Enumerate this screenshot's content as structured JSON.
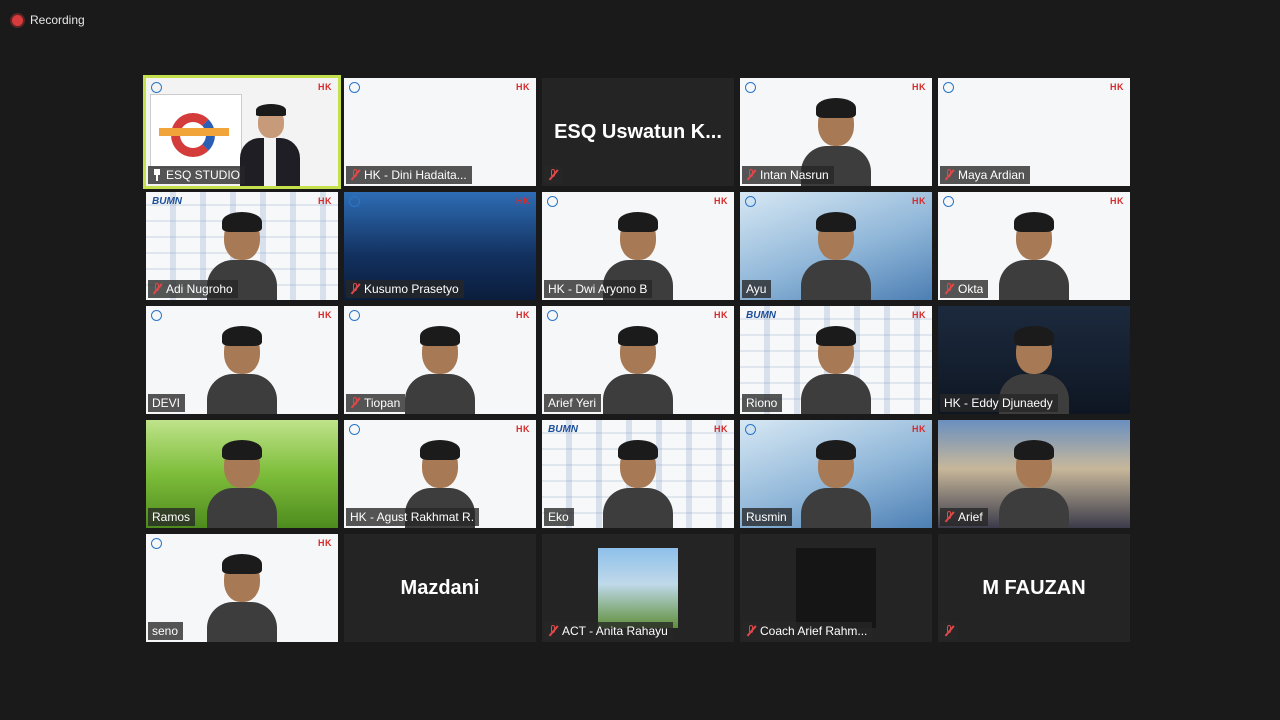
{
  "recording": {
    "label": "Recording"
  },
  "tiles": [
    {
      "name": "ESQ STUDIO",
      "type": "studio",
      "active": true,
      "label_icon": "pin"
    },
    {
      "name": "HK - Dini Hadaita...",
      "type": "blank",
      "label_icon": "mic-muted"
    },
    {
      "name": "ESQ  Uswatun  K...",
      "type": "name-only",
      "label_icon": "mic-muted"
    },
    {
      "name": "Intan Nasrun",
      "type": "video-white",
      "label_icon": "mic-muted"
    },
    {
      "name": "Maya Ardian",
      "type": "blank",
      "label_icon": "mic-muted"
    },
    {
      "name": "Adi Nugroho",
      "type": "video-bumn",
      "label_icon": "mic-muted"
    },
    {
      "name": "Kusumo Prasetyo",
      "type": "blue-slide",
      "label_icon": "mic-muted"
    },
    {
      "name": "HK - Dwi Aryono B",
      "type": "video-white",
      "label_icon": "none"
    },
    {
      "name": "Ayu",
      "type": "video-sky",
      "label_icon": "none"
    },
    {
      "name": "Okta",
      "type": "video-white",
      "label_icon": "mic-muted"
    },
    {
      "name": "DEVI",
      "type": "video-white",
      "label_icon": "none"
    },
    {
      "name": "Tiopan",
      "type": "video-white",
      "label_icon": "mic-muted"
    },
    {
      "name": "Arief Yeri",
      "type": "video-white",
      "label_icon": "none"
    },
    {
      "name": "Riono",
      "type": "video-bumn",
      "label_icon": "none"
    },
    {
      "name": "HK - Eddy Djunaedy",
      "type": "video-dark",
      "label_icon": "none"
    },
    {
      "name": "Ramos",
      "type": "video-green",
      "label_icon": "none"
    },
    {
      "name": "HK - Agust Rakhmat R.",
      "type": "video-white",
      "label_icon": "none"
    },
    {
      "name": "Eko",
      "type": "video-bumn",
      "label_icon": "none"
    },
    {
      "name": "Rusmin",
      "type": "video-sky",
      "label_icon": "none"
    },
    {
      "name": "Arief",
      "type": "video-mosque",
      "label_icon": "mic-muted"
    },
    {
      "name": "seno",
      "type": "video-white",
      "label_icon": "none"
    },
    {
      "name": "Mazdani",
      "type": "name-only-clean",
      "label_icon": "none"
    },
    {
      "name": "ACT - Anita Rahayu",
      "type": "avatar-a",
      "label_icon": "mic-muted"
    },
    {
      "name": "Coach Arief Rahm...",
      "type": "avatar-b",
      "label_icon": "mic-muted"
    },
    {
      "name": "M FAUZAN",
      "type": "name-only",
      "label_icon": "mic-muted"
    }
  ],
  "logos": {
    "hk": "HK",
    "bumn": "BUMN"
  },
  "colors": {
    "active_border": "#c4e04d",
    "muted_mic": "#e04848",
    "background": "#1a1a1a"
  }
}
